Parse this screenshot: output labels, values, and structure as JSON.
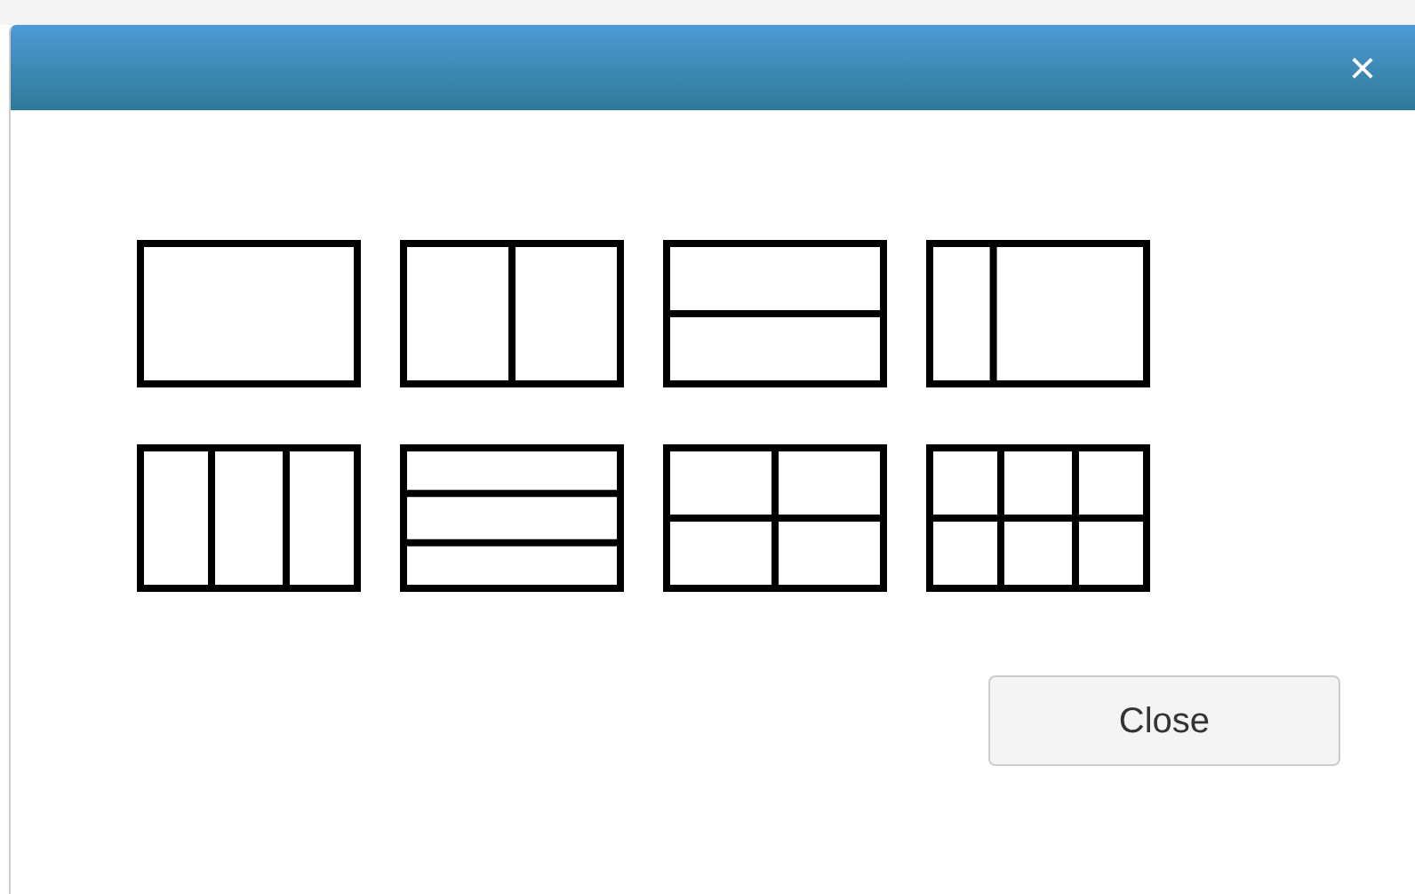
{
  "dialog": {
    "close_icon": "×"
  },
  "layouts": [
    {
      "kind": "single"
    },
    {
      "kind": "two-columns"
    },
    {
      "kind": "two-rows"
    },
    {
      "kind": "sidebar-left"
    },
    {
      "kind": "three-columns"
    },
    {
      "kind": "three-rows"
    },
    {
      "kind": "grid-2x2"
    },
    {
      "kind": "grid-3x2"
    }
  ],
  "buttons": [
    {
      "label": "Close"
    }
  ]
}
